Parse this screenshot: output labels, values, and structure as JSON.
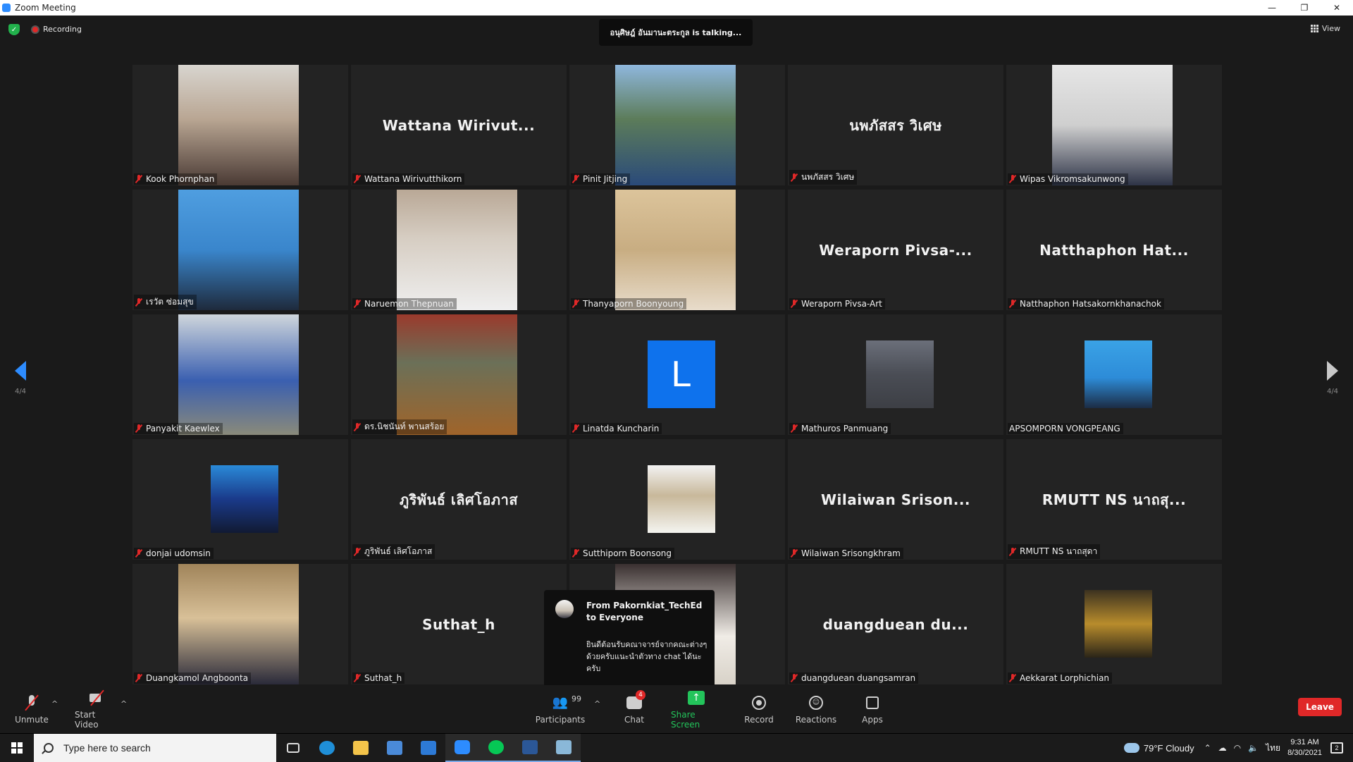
{
  "window": {
    "title": "Zoom Meeting",
    "controls": [
      "—",
      "❐",
      "✕"
    ]
  },
  "status": {
    "recording_label": "Recording",
    "talking": "อนุศิษฎ์ อันมานะตระกูล is talking...",
    "view_label": "View"
  },
  "paging": {
    "left": "4/4",
    "right": "4/4"
  },
  "tiles": [
    {
      "name": "Kook Phornphan",
      "kind": "photo",
      "big": "",
      "muted": true
    },
    {
      "name": "Wattana Wirivutthikorn",
      "kind": "name",
      "big": "Wattana Wirivut...",
      "muted": true
    },
    {
      "name": "Pinit Jitjing",
      "kind": "photo",
      "big": "",
      "muted": true
    },
    {
      "name": "นพภัสสร วิเศษ",
      "kind": "name",
      "big": "นพภัสสร วิเศษ",
      "muted": true
    },
    {
      "name": "Wipas Vikromsakunwong",
      "kind": "photo",
      "big": "",
      "muted": true
    },
    {
      "name": "เรวัต ซ่อมสุข",
      "kind": "photo",
      "big": "",
      "muted": true
    },
    {
      "name": "Naruemon Thepnuan",
      "kind": "photo",
      "big": "",
      "muted": true
    },
    {
      "name": "Thanyaporn Boonyoung",
      "kind": "photo",
      "big": "",
      "muted": true
    },
    {
      "name": "Weraporn Pivsa-Art",
      "kind": "name",
      "big": "Weraporn Pivsa-...",
      "muted": true
    },
    {
      "name": "Natthaphon Hatsakornkhanachok",
      "kind": "name",
      "big": "Natthaphon Hat...",
      "muted": true
    },
    {
      "name": "Panyakit Kaewlex",
      "kind": "photo",
      "big": "",
      "muted": true
    },
    {
      "name": "ดร.นิชนันท์ พานสร้อย",
      "kind": "photo",
      "big": "",
      "muted": true
    },
    {
      "name": "Linatda Kuncharin",
      "kind": "letter",
      "big": "L",
      "muted": true
    },
    {
      "name": "Mathuros Panmuang",
      "kind": "avatar",
      "big": "",
      "muted": true
    },
    {
      "name": "APSOMPORN VONGPEANG",
      "kind": "avatar",
      "big": "",
      "muted": false
    },
    {
      "name": "donjai udomsin",
      "kind": "avatar",
      "big": "",
      "muted": true
    },
    {
      "name": "ภูริพันธ์ เลิศโอภาส",
      "kind": "name",
      "big": "ภูริพันธ์ เลิศโอภาส",
      "muted": true
    },
    {
      "name": "Sutthiporn Boonsong",
      "kind": "avatar",
      "big": "",
      "muted": true
    },
    {
      "name": "Wilaiwan Srisongkhram",
      "kind": "name",
      "big": "Wilaiwan Srison...",
      "muted": true
    },
    {
      "name": "RMUTT NS นาถสุดา",
      "kind": "name",
      "big": "RMUTT NS นาถสุ...",
      "muted": true
    },
    {
      "name": "Duangkamol Angboonta",
      "kind": "photo",
      "big": "",
      "muted": true
    },
    {
      "name": "Suthat_h",
      "kind": "name",
      "big": "Suthat_h",
      "muted": true
    },
    {
      "name": "",
      "kind": "photo",
      "big": "",
      "muted": false
    },
    {
      "name": "duangduean duangsamran",
      "kind": "name",
      "big": "duangduean du...",
      "muted": true
    },
    {
      "name": "Aekkarat Lorphichian",
      "kind": "avatar",
      "big": "",
      "muted": true
    }
  ],
  "chat_popup": {
    "from": "From Pakornkiat_TechEd to Everyone",
    "message": "ยินดีต้อนรับคณาจารย์จากคณะต่างๆ ด้วยครับแนะนำตัวทาง chat ได้นะครับ"
  },
  "toolbar": {
    "unmute": "Unmute",
    "start_video": "Start Video",
    "participants": "Participants",
    "participants_count": "99",
    "chat": "Chat",
    "chat_badge": "4",
    "share_screen": "Share Screen",
    "record": "Record",
    "reactions": "Reactions",
    "apps": "Apps",
    "leave": "Leave",
    "caret": "^"
  },
  "taskbar": {
    "search_placeholder": "Type here to search",
    "weather": "79°F  Cloudy",
    "lang": "ไทย",
    "time": "9:31 AM",
    "date": "8/30/2021",
    "notif_count": "2"
  },
  "colors": {
    "accent": "#2d8cff",
    "share_green": "#23c45b",
    "leave_red": "#e02828",
    "muted_red": "#e02828",
    "tile_bg": "#232323"
  }
}
